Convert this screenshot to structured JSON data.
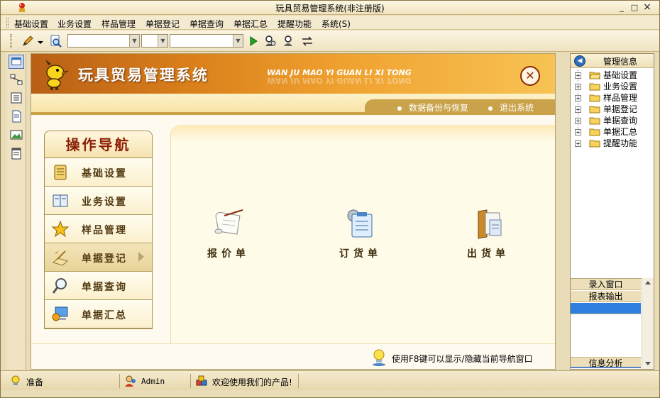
{
  "window": {
    "title": "玩具贸易管理系统(非注册版)",
    "minimize": "_",
    "maximize": "□",
    "close": "×"
  },
  "menu": {
    "items": [
      "基础设置",
      "业务设置",
      "样品管理",
      "单据登记",
      "单据查询",
      "单据汇总",
      "提醒功能",
      "系统(S)"
    ]
  },
  "toolbar": {
    "combos": [
      "",
      "",
      ""
    ]
  },
  "banner": {
    "system_title": "玩具贸易管理系统",
    "pinyin": "WAN JU MAO YI GUAN LI XI TONG"
  },
  "subbar": {
    "backup_link": "数据备份与恢复",
    "exit_link": "退出系统"
  },
  "nav": {
    "title": "操作导航",
    "items": [
      {
        "label": "基础设置",
        "icon": "notebook-icon"
      },
      {
        "label": "业务设置",
        "icon": "book-icon"
      },
      {
        "label": "样品管理",
        "icon": "star-icon"
      },
      {
        "label": "单据登记",
        "icon": "edit-icon",
        "active": true
      },
      {
        "label": "单据查询",
        "icon": "magnifier-icon"
      },
      {
        "label": "单据汇总",
        "icon": "monitor-icon"
      }
    ]
  },
  "documents": [
    {
      "label": "报价单",
      "icon": "quote-scroll-icon"
    },
    {
      "label": "订货单",
      "icon": "order-clipboard-icon"
    },
    {
      "label": "出货单",
      "icon": "shipping-folder-icon"
    }
  ],
  "hint": "使用F8键可以显示/隐藏当前导航窗口",
  "right_panel": {
    "title": "管理信息",
    "tree": [
      "基础设置",
      "业务设置",
      "样品管理",
      "单据登记",
      "单据查询",
      "单据汇总",
      "提醒功能"
    ],
    "list": [
      "录入窗口",
      "报表输出"
    ],
    "info_tab": "信息分析"
  },
  "status": {
    "ready": "准备",
    "user": "Admin",
    "welcome": "欢迎使用我们的产品!"
  },
  "colors": {
    "banner_start": "#b85f16",
    "banner_end": "#f7c354",
    "nav_title": "#8b1e06",
    "selection": "#2f7fe0"
  }
}
